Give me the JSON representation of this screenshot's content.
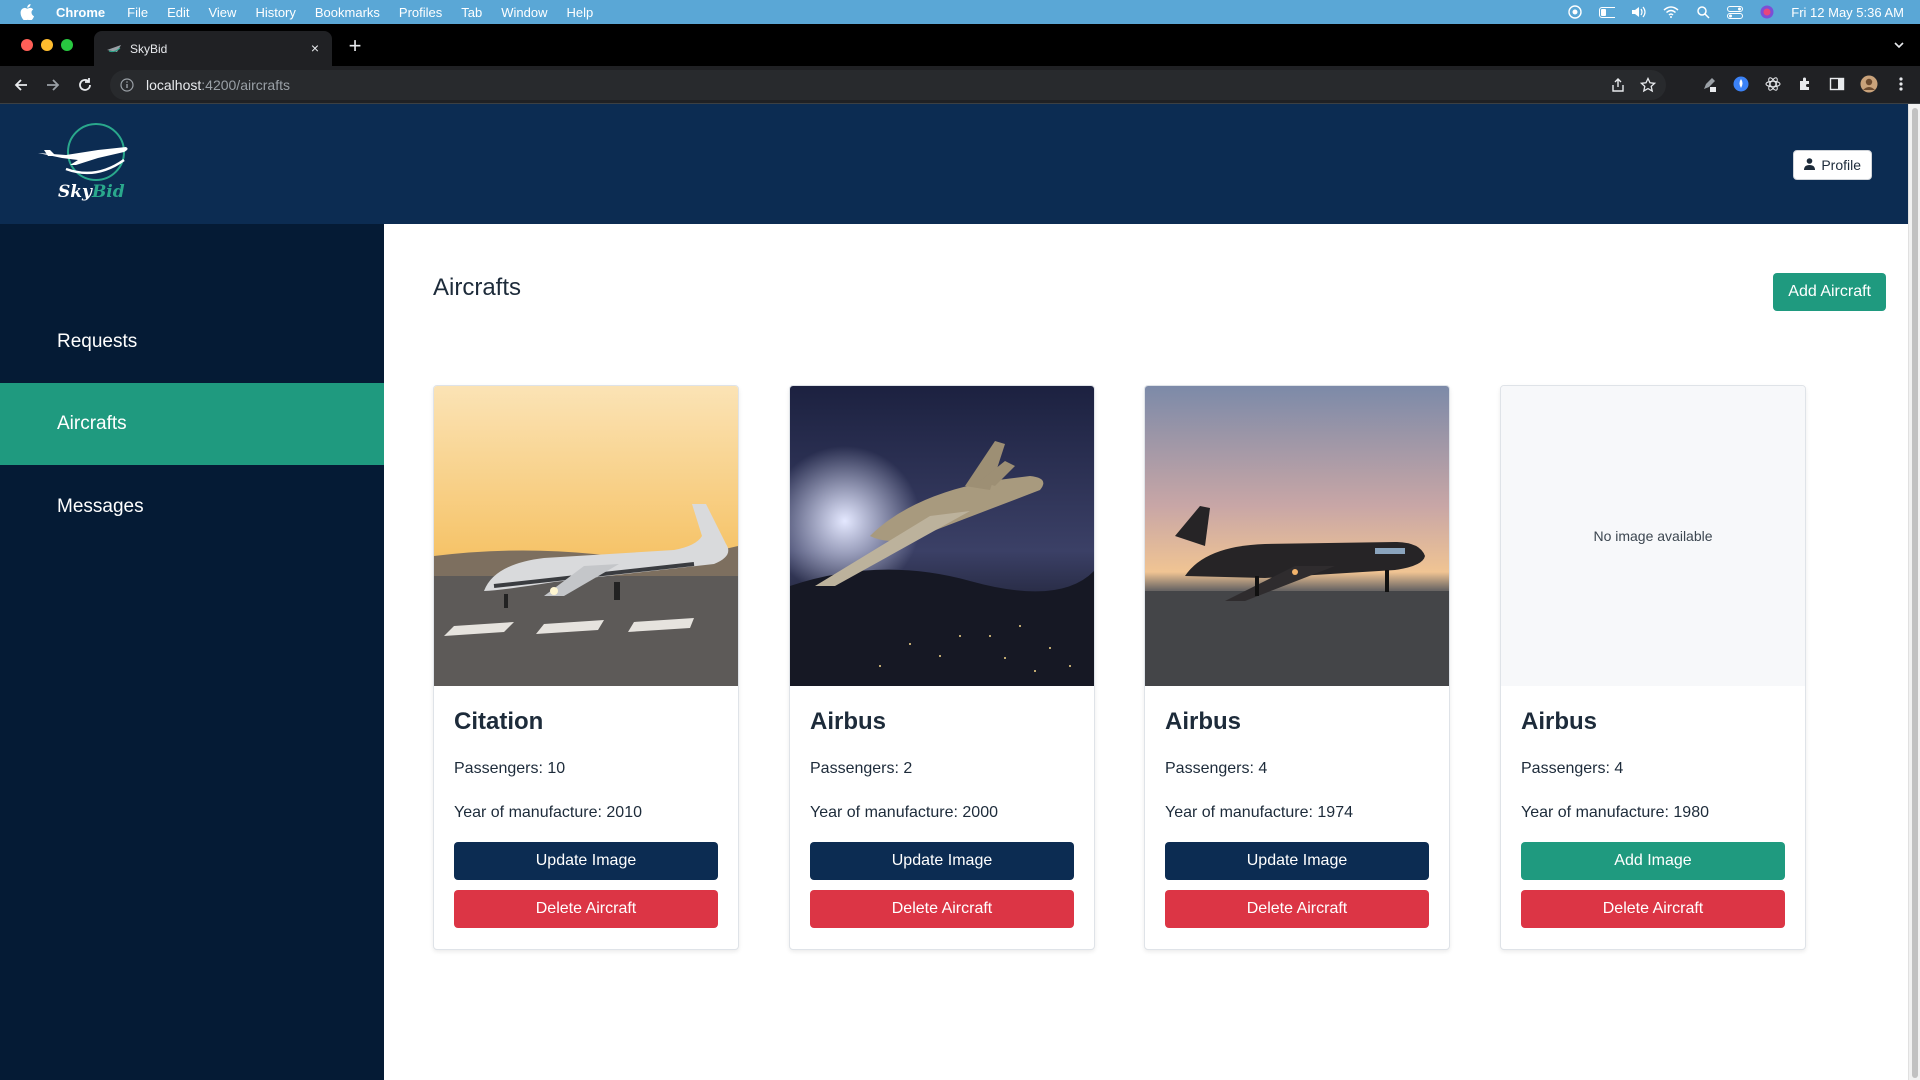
{
  "menubar": {
    "app": "Chrome",
    "items": [
      "File",
      "Edit",
      "View",
      "History",
      "Bookmarks",
      "Profiles",
      "Tab",
      "Window",
      "Help"
    ],
    "clock": "Fri 12 May  5:36 AM"
  },
  "browser": {
    "tab_title": "SkyBid",
    "url_host": "localhost",
    "url_path": ":4200/aircrafts"
  },
  "header": {
    "logo_sky": "Sky",
    "logo_bid": "Bid",
    "profile_label": "Profile"
  },
  "sidebar": {
    "items": [
      {
        "label": "Requests"
      },
      {
        "label": "Aircrafts"
      },
      {
        "label": "Messages"
      }
    ],
    "active_index": 1
  },
  "main": {
    "title": "Aircrafts",
    "add_button": "Add Aircraft",
    "cards": [
      {
        "name": "Citation",
        "passengers": "Passengers: 10",
        "year": "Year of manufacture: 2010",
        "image_button": "Update Image",
        "delete_button": "Delete Aircraft",
        "has_image": true
      },
      {
        "name": "Airbus",
        "passengers": "Passengers: 2",
        "year": "Year of manufacture: 2000",
        "image_button": "Update Image",
        "delete_button": "Delete Aircraft",
        "has_image": true
      },
      {
        "name": "Airbus",
        "passengers": "Passengers: 4",
        "year": "Year of manufacture: 1974",
        "image_button": "Update Image",
        "delete_button": "Delete Aircraft",
        "has_image": true
      },
      {
        "name": "Airbus",
        "passengers": "Passengers: 4",
        "year": "Year of manufacture: 1980",
        "image_button": "Add Image",
        "delete_button": "Delete Aircraft",
        "has_image": false,
        "placeholder": "No image available"
      }
    ]
  },
  "colors": {
    "header_bg": "#0c2c52",
    "sidebar_bg": "#051b35",
    "accent": "#1f9a7f",
    "danger": "#dc3545"
  }
}
